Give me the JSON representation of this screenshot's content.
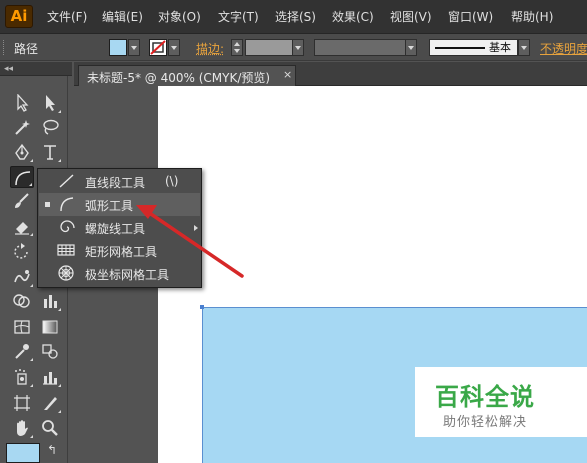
{
  "app": {
    "logo": "Ai",
    "menu": [
      "文件(F)",
      "编辑(E)",
      "对象(O)",
      "文字(T)",
      "选择(S)",
      "效果(C)",
      "视图(V)",
      "窗口(W)",
      "帮助(H)"
    ]
  },
  "control_bar": {
    "selection_label": "路径",
    "fill_color": "#a8d8f2",
    "stroke_label": "描边:",
    "brush_label": "基本",
    "opacity_label": "不透明度"
  },
  "toolbar": {
    "collapse": "◂◂",
    "swap": "↰"
  },
  "document": {
    "tab_title": "未标题-5* @ 400% (CMYK/预览)",
    "tab_close": "×"
  },
  "flyout": {
    "items": [
      {
        "icon": "line-segment-icon",
        "label": "直线段工具",
        "shortcut": "(\\)"
      },
      {
        "icon": "arc-icon",
        "label": "弧形工具",
        "shortcut": ""
      },
      {
        "icon": "spiral-icon",
        "label": "螺旋线工具",
        "shortcut": ""
      },
      {
        "icon": "rectangular-grid-icon",
        "label": "矩形网格工具",
        "shortcut": ""
      },
      {
        "icon": "polar-grid-icon",
        "label": "极坐标网格工具",
        "shortcut": ""
      }
    ]
  },
  "watermark": {
    "title": "百科全说",
    "subtitle": "助你轻松解决"
  },
  "colors": {
    "accent_orange": "#e8a33d",
    "annotation_red": "#d62828",
    "rectangle_fill": "#a6d8f3",
    "watermark_green": "#3aa848"
  }
}
